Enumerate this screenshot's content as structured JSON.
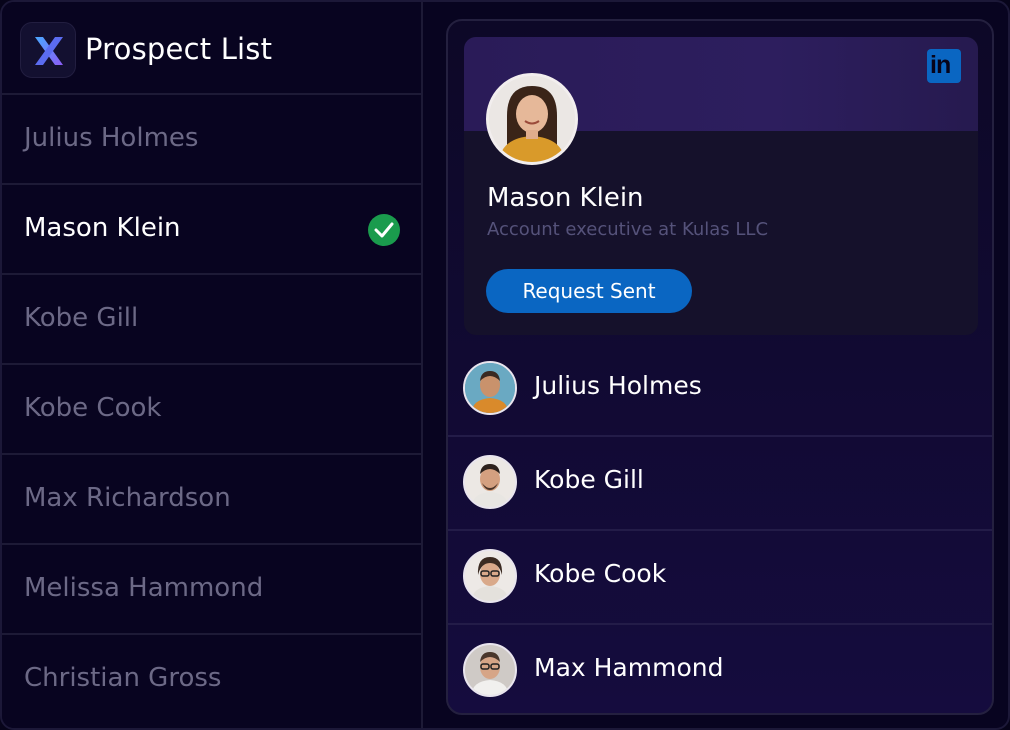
{
  "sidebar": {
    "logo_icon": "x-logo-icon",
    "title": "Prospect List",
    "prospects": [
      {
        "name": "Julius Holmes",
        "selected": false
      },
      {
        "name": "Mason Klein",
        "selected": true
      },
      {
        "name": "Kobe Gill",
        "selected": false
      },
      {
        "name": "Kobe Cook",
        "selected": false
      },
      {
        "name": "Max Richardson",
        "selected": false
      },
      {
        "name": "Melissa Hammond",
        "selected": false
      },
      {
        "name": "Christian Gross",
        "selected": false
      }
    ],
    "selected_icon": "check-circle-icon"
  },
  "profile_card": {
    "network_icon": "linkedin-icon",
    "network_label": "in",
    "avatar_icon": "profile-photo",
    "name": "Mason Klein",
    "role": "Account executive at Kulas LLC",
    "button_label": "Request Sent"
  },
  "people": [
    {
      "name": "Julius Holmes",
      "avatar": "avatar-photo"
    },
    {
      "name": "Kobe Gill",
      "avatar": "avatar-photo"
    },
    {
      "name": "Kobe Cook",
      "avatar": "avatar-photo"
    },
    {
      "name": "Max Hammond",
      "avatar": "avatar-photo"
    }
  ],
  "colors": {
    "background": "#080420",
    "accent_blue": "#0a66c2",
    "check_green": "#1a9b4d",
    "muted_text": "#6c6986"
  }
}
